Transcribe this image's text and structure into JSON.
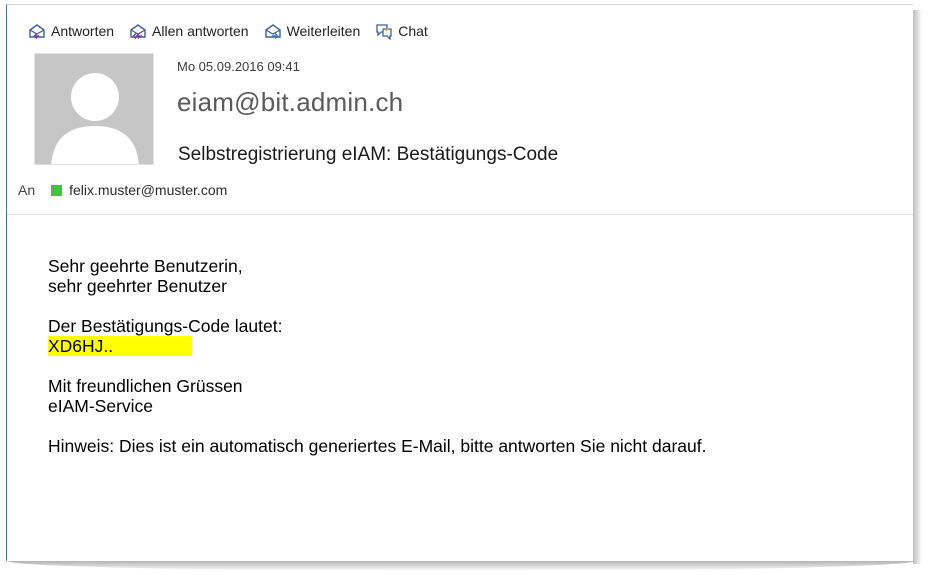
{
  "toolbar": {
    "reply_label": "Antworten",
    "reply_all_label": "Allen antworten",
    "forward_label": "Weiterleiten",
    "chat_label": "Chat"
  },
  "message": {
    "date": "Mo 05.09.2016 09:41",
    "sender": "eiam@bit.admin.ch",
    "subject": "Selbstregistrierung eIAM: Bestätigungs-Code",
    "to_label": "An",
    "recipient": "felix.muster@muster.com",
    "presence_color": "#3fc43b"
  },
  "body": {
    "greeting_1": "Sehr geehrte Benutzerin,",
    "greeting_2": "sehr geehrter Benutzer",
    "code_intro": "Der Bestätigungs-Code lautet:",
    "code": "XD6HJ..",
    "closing_1": "Mit freundlichen Grüssen",
    "closing_2": "eIAM-Service",
    "note": "Hinweis: Dies ist ein automatisch generiertes E-Mail, bitte antworten Sie nicht darauf."
  }
}
